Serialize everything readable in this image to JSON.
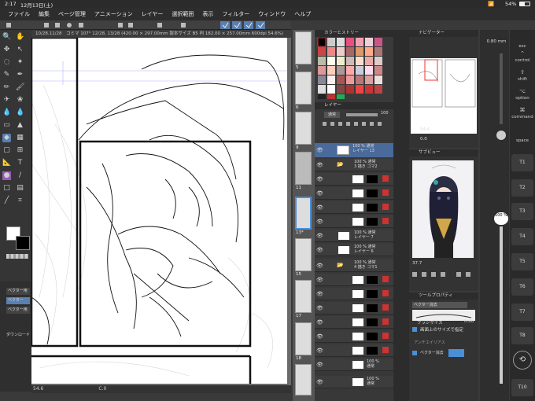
{
  "status": {
    "time": "2:17",
    "date": "12月13日(土)",
    "battery": "54%"
  },
  "menu": [
    "ファイル",
    "編集",
    "ページ管理",
    "アニメーション",
    "レイヤー",
    "選択範囲",
    "表示",
    "フィルター",
    "ウィンドウ",
    "ヘルプ"
  ],
  "doc": {
    "tab": "10/28.11/28",
    "title": "コミマ 107° 12/28, 13/28 (420.00 × 297.00mm 製本サイズ B5 判 182.00 × 257.00mm 600dpi 54.6%)",
    "zoom": "54.6",
    "coord": "C.0"
  },
  "pages": [
    "5",
    "6",
    "7",
    "8",
    "9",
    "10",
    "11",
    "12",
    "13*",
    "14",
    "15",
    "16",
    "17",
    "18"
  ],
  "color_history": {
    "title": "カラーヒストリー"
  },
  "layers": {
    "title": "レイヤー",
    "blend": "通常",
    "opacity": "100",
    "folders": [
      "100 % 通常\n3 描き コマ2",
      "100 % 通常\nレイヤー 7",
      "100 % 通常\nレイヤー 6",
      "100 % 通常\n4 描き コマ1",
      "100 %\n通常",
      "100 %\n通常"
    ],
    "first": "100 % 通常\nレイヤー 13"
  },
  "navigator": {
    "title": "ナビゲーター",
    "zoom": "54.6",
    "angle": "0.0"
  },
  "subview": {
    "title": "サブビュー",
    "zoom": "37.7"
  },
  "toolprop": {
    "title": "ツールプロパティ",
    "tool": "ベクター消去",
    "brush_size_label": "ブラシサイズ",
    "brush_size": "0.80",
    "fit_label": "画面上のサイズで指定",
    "antialias": "アンチエイリアス",
    "vector_erase": "ベクター消去"
  },
  "sliders": {
    "size": "0.80 mm",
    "opacity": "100 %"
  },
  "tools_left": {
    "sub1": "ベクター用",
    "sub2": "ベクター",
    "sub3": "ベクター用",
    "sub4": "ダウンロード"
  },
  "keys": [
    "esc",
    "control",
    "shift",
    "option",
    "command",
    "space",
    "T1",
    "T2",
    "T3",
    "T4",
    "T5",
    "T6",
    "T7",
    "T8",
    "T9",
    "T10"
  ],
  "key_labels": {
    "control": "control",
    "shift": "shift",
    "option": "option",
    "command": "command",
    "space": "space"
  },
  "colors": {
    "accent": "#4a90d9",
    "selected": "#5a7fb0",
    "main_color": "#ffffff",
    "sub_color": "#000000"
  }
}
